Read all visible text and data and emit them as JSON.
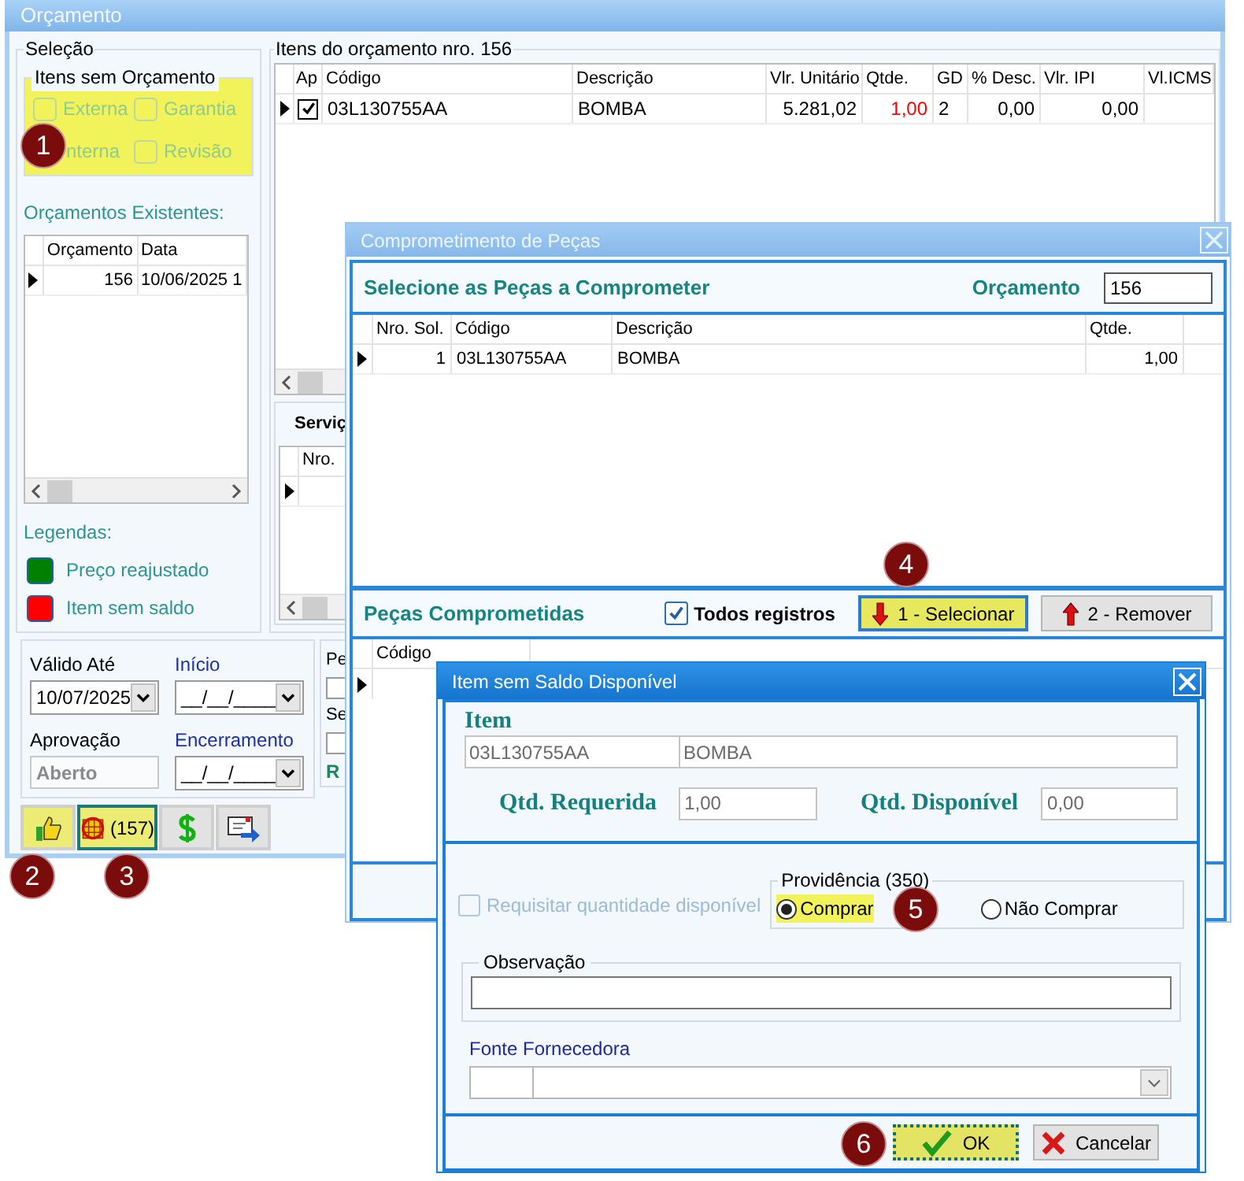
{
  "main_window": {
    "title": "Orçamento",
    "selection": {
      "title": "Seleção",
      "group": {
        "title": "Itens sem Orçamento",
        "highlighted": true,
        "options": [
          {
            "label": "Externa",
            "kind": "checkbox",
            "checked": false,
            "disabled": true
          },
          {
            "label": "Garantia",
            "kind": "checkbox",
            "checked": false,
            "disabled": true
          },
          {
            "label": "nterna",
            "kind": "label_only",
            "disabled": true
          },
          {
            "label": "Revisão",
            "kind": "checkbox",
            "checked": false,
            "disabled": true
          }
        ]
      },
      "existing_label": "Orçamentos Existentes:",
      "existing_table": {
        "columns": [
          "Orçamento",
          "Data"
        ],
        "rows": [
          {
            "current": true,
            "cells": [
              "156",
              "10/06/2025 1"
            ]
          }
        ]
      },
      "legend_title": "Legendas:",
      "legend": [
        {
          "label": "Preço reajustado",
          "color": "#008000"
        },
        {
          "label": "Item sem saldo",
          "color": "#ff0000"
        }
      ]
    },
    "items": {
      "title": "Itens do orçamento nro. 156",
      "check_column": "Ap",
      "columns": [
        "Código",
        "Descrição",
        "Vlr. Unitário",
        "Qtde.",
        "GD",
        "% Desc.",
        "Vlr. IPI",
        "Vl.ICMS"
      ],
      "rows": [
        {
          "current": true,
          "approved": true,
          "out_of_stock": true,
          "cells": [
            "03L130755AA",
            "BOMBA",
            "5.281,02",
            "1,00",
            "2",
            "0,00",
            "0,00"
          ]
        }
      ]
    },
    "services": {
      "title": "Serviç",
      "columns": [
        "Nro."
      ],
      "rows": [
        {
          "current": true
        }
      ]
    },
    "dates": [
      {
        "label": "Válido Até",
        "value": "10/07/2025",
        "kind": "date",
        "required": false
      },
      {
        "label": "Início",
        "value": "__/__/____",
        "kind": "date",
        "required": true
      },
      {
        "label": "Aprovação",
        "value": "Aberto",
        "kind": "status",
        "required": false
      },
      {
        "label": "Encerramento",
        "value": "__/__/____",
        "kind": "date",
        "required": true
      }
    ],
    "side_labels": [
      {
        "text": "Pe",
        "kind": "field"
      },
      {
        "text": "Se",
        "kind": "field"
      },
      {
        "text": "R",
        "kind": "heading"
      }
    ],
    "toolbar": [
      {
        "kind": "approve",
        "highlighted": true,
        "focused": false
      },
      {
        "kind": "calendar",
        "label": "(157)",
        "highlighted": true,
        "focused": true
      },
      {
        "kind": "money",
        "highlighted": false,
        "focused": false
      },
      {
        "kind": "send",
        "highlighted": false,
        "focused": false
      }
    ]
  },
  "commit_dialog": {
    "title": "Comprometimento de Peças",
    "heading": "Selecione as Peças a Comprometer",
    "budget_label": "Orçamento",
    "budget_value": "156",
    "table": {
      "columns": [
        "Nro. Sol.",
        "Código",
        "Descrição",
        "Qtde."
      ],
      "rows": [
        {
          "current": true,
          "cells": [
            "1",
            "03L130755AA",
            "BOMBA",
            "1,00"
          ]
        }
      ]
    },
    "committed": {
      "title": "Peças Comprometidas",
      "all_records": {
        "label": "Todos registros",
        "checked": true
      },
      "buttons": [
        {
          "label": "1 - Selecionar",
          "kind": "down",
          "highlighted": true
        },
        {
          "label": "2 - Remover",
          "kind": "up",
          "highlighted": false
        }
      ],
      "columns": [
        "Código"
      ],
      "rows": [
        {
          "current": true
        }
      ]
    }
  },
  "stock_dialog": {
    "title": "Item sem Saldo Disponível",
    "item_label": "Item",
    "item_code": "03L130755AA",
    "item_description": "BOMBA",
    "required_label": "Qtd. Requerida",
    "required_value": "1,00",
    "available_label": "Qtd. Disponível",
    "available_value": "0,00",
    "request_available": {
      "label": "Requisitar quantidade disponível",
      "checked": false,
      "disabled": true
    },
    "action": {
      "title": "Providência (350)",
      "options": [
        {
          "label": "Comprar",
          "selected": true,
          "highlighted": true
        },
        {
          "label": "Não Comprar",
          "selected": false,
          "highlighted": false
        }
      ]
    },
    "note_label": "Observação",
    "supplier_label": "Fonte Fornecedora",
    "buttons": [
      {
        "label": "OK",
        "kind": "ok",
        "highlighted": true
      },
      {
        "label": "Cancelar",
        "kind": "cancel",
        "highlighted": false
      }
    ]
  },
  "badges": [
    {
      "text": "1"
    },
    {
      "text": "2"
    },
    {
      "text": "3"
    },
    {
      "text": "4"
    },
    {
      "text": "5"
    },
    {
      "text": "6"
    }
  ]
}
